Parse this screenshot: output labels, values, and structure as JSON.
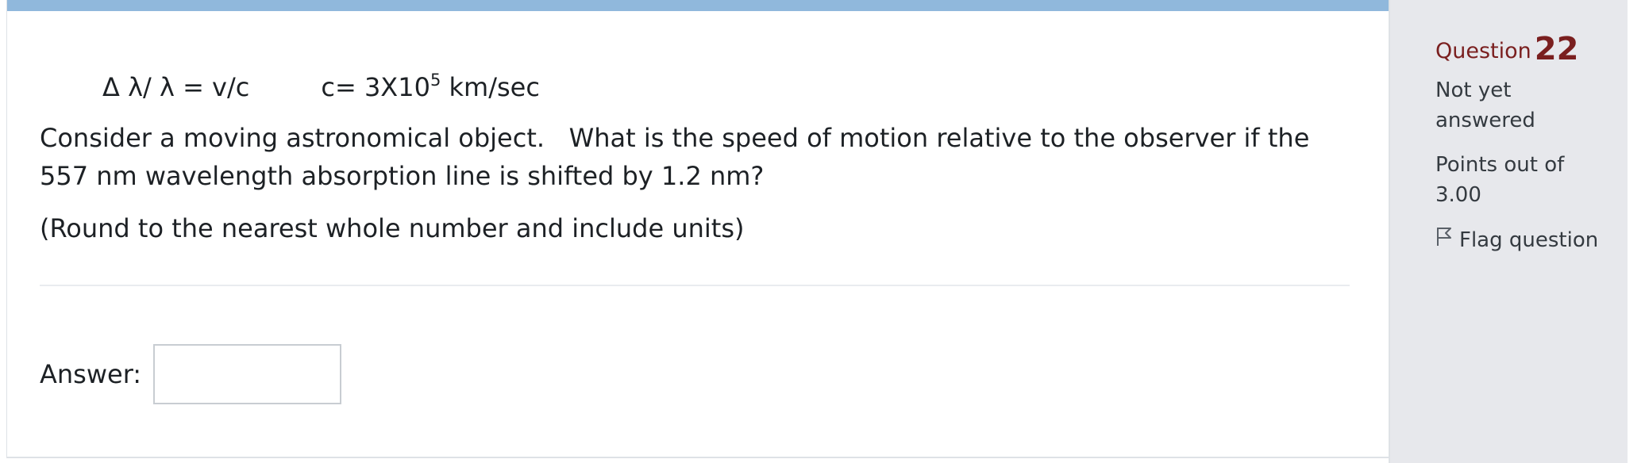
{
  "question": {
    "formula": {
      "ratio": "Δ λ/ λ = v/c",
      "c_prefix": "c= 3X10",
      "c_exponent": "5",
      "c_units": " km/sec"
    },
    "text": "Consider a moving astronomical object.   What is the speed of motion relative to the observer if the 557 nm wavelength absorption line is shifted by 1.2 nm?",
    "note": "(Round to the nearest whole number and include units)",
    "answer_label": "Answer:",
    "answer_value": ""
  },
  "info": {
    "question_label": "Question",
    "question_number": "22",
    "status": "Not yet answered",
    "points": "Points out of 3.00",
    "flag_label": "Flag question"
  },
  "colors": {
    "top_bar": "#90b8dc",
    "question_accent": "#7a1f1f",
    "info_background": "#e7e8ec"
  }
}
